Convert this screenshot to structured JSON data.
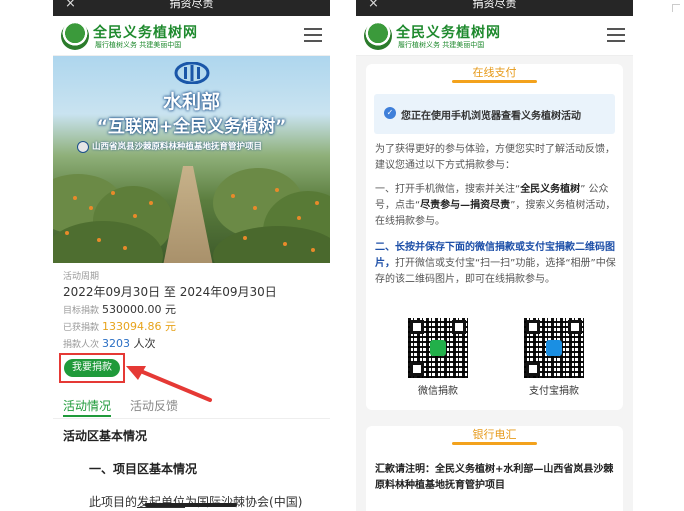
{
  "left": {
    "topbar": {
      "title": "捐资尽责",
      "close": "×",
      "more": "···"
    },
    "header": {
      "logo_title": "全民义务植树网",
      "logo_sub": "履行植树义务  共建美丽中国"
    },
    "banner": {
      "line1": "水利部",
      "line2": "“互联网+全民义务植树”",
      "line3": "山西省岚县沙棘原料林种植基地抚育管护项目"
    },
    "info": {
      "period_label": "活动周期",
      "period": "2022年09月30日 至 2024年09月30日",
      "target_label": "目标捐款",
      "target": "530000.00 元",
      "raised_label": "已获捐款",
      "raised": "133094.86 元",
      "count_label": "捐款人次",
      "count": "3203",
      "count_unit": "人次",
      "donate_button": "我要捐款"
    },
    "tabs": [
      {
        "label": "活动情况",
        "active": true
      },
      {
        "label": "活动反馈",
        "active": false
      }
    ],
    "content": {
      "heading": "活动区基本情况",
      "subheading": "一、项目区基本情况",
      "para_pre": "此项目的",
      "para_link": "发起单位",
      "para_post": "为国际沙棘协会(中国)"
    }
  },
  "right": {
    "topbar": {
      "title": "捐资尽责",
      "close": "×",
      "more": "···"
    },
    "header": {
      "logo_title": "全民义务植树网",
      "logo_sub": "履行植树义务  共建美丽中国"
    },
    "pay": {
      "title": "在线支付",
      "notice": "您正在使用手机浏览器查看义务植树活动",
      "intro": "为了获得更好的参与体验，方便您实时了解活动反馈，建议您通过以下方式捐款参与：",
      "step1_pre": "一、打开手机微信，搜索并关注“",
      "step1_b1": "全民义务植树",
      "step1_mid": "” 公众号，点击“",
      "step1_b2": "尽责参与—捐资尽责",
      "step1_post": "”，搜索义务植树活动，在线捐款参与。",
      "step2_blue": "二、长按并保存下面的微信捐款或支付宝捐款二维码图片，",
      "step2_post": "打开微信或支付宝“扫一扫”功能，选择“相册”中保存的该二维码图片，即可在线捐款参与。",
      "wechat_label": "微信捐款",
      "alipay_label": "支付宝捐款"
    },
    "bank": {
      "title": "银行电汇",
      "note": "汇款请注明：全民义务植树+水利部—山西省岚县沙棘原料林种植基地抚育管护项目"
    }
  }
}
